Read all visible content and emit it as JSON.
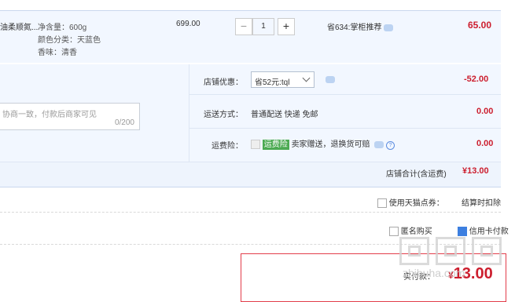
{
  "item": {
    "title": "油柔顺氮...",
    "specs": [
      "净含量：600g",
      "颜色分类：天蓝色",
      "香味：清香"
    ],
    "price": "699.00",
    "quantity": "1",
    "minus": "−",
    "plus": "+",
    "promo": "省634:掌柜推荐",
    "subtotal": "65.00"
  },
  "shop": {
    "memo_placeholder": "协商一致，付款后商家可见",
    "memo_count": "0/200",
    "coupon_label": "店铺优惠：",
    "coupon_selected": "省52元:tql",
    "coupon_amount": "-52.00",
    "shipping_label": "运送方式：",
    "shipping_value": "普通配送 快递 免邮",
    "shipping_amount": "0.00",
    "insurance_label": "运费险：",
    "insurance_badge": "运费险",
    "insurance_text": "卖家赠送，退换货可赔",
    "insurance_amount": "0.00",
    "total_label": "店铺合计(含运费)",
    "total_amount": "¥13.00"
  },
  "options": {
    "tmall_points": "使用天猫点券：",
    "settle_note": "结算时扣除",
    "anonymous": "匿名购买",
    "pay_method": "信用卡付款"
  },
  "payment": {
    "label": "实付款：",
    "amount": "13.00",
    "currency": "¥"
  },
  "watermark": {
    "text": "zhibuha.com"
  }
}
